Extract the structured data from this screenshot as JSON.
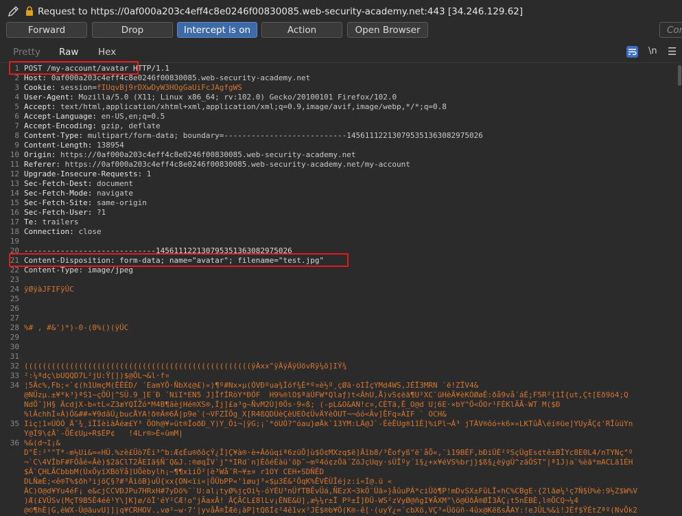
{
  "header": {
    "title": "Request to https://0af000a203c4eff4c8e0246f00830085.web-security-academy.net:443  [34.246.129.62]"
  },
  "toolbar": {
    "forward": "Forward",
    "drop": "Drop",
    "intercept": "Intercept is on",
    "action": "Action",
    "open_browser": "Open Browser",
    "comment_placeholder": "Comment this item"
  },
  "tabs": {
    "pretty": "Pretty",
    "raw": "Raw",
    "hex": "Hex",
    "newline": "\\n"
  },
  "editor": {
    "lines": [
      {
        "n": "1",
        "t": "POST /my-account/avatar HTTP/1.1"
      },
      {
        "n": "2",
        "t": "Host: 0af000a203c4eff4c8e0246f00830085.web-security-academy.net"
      },
      {
        "n": "3",
        "t": "Cookie: session=fIUqvBj9rDXwDyW3HOgGaUiFcJAgfgWS"
      },
      {
        "n": "4",
        "t": "User-Agent: Mozilla/5.0 (X11; Linux x86_64; rv:102.0) Gecko/20100101 Firefox/102.0"
      },
      {
        "n": "5",
        "t": "Accept: text/html,application/xhtml+xml,application/xml;q=0.9,image/avif,image/webp,*/*;q=0.8"
      },
      {
        "n": "6",
        "t": "Accept-Language: en-US,en;q=0.5"
      },
      {
        "n": "7",
        "t": "Accept-Encoding: gzip, deflate"
      },
      {
        "n": "8",
        "t": "Content-Type: multipart/form-data; boundary=---------------------------145611122130795351363082975026"
      },
      {
        "n": "9",
        "t": "Content-Length: 138954"
      },
      {
        "n": "10",
        "t": "Origin: https://0af000a203c4eff4c8e0246f00830085.web-security-academy.net"
      },
      {
        "n": "11",
        "t": "Referer: https://0af000a203c4eff4c8e0246f00830085.web-security-academy.net/my-account"
      },
      {
        "n": "12",
        "t": "Upgrade-Insecure-Requests: 1"
      },
      {
        "n": "13",
        "t": "Sec-Fetch-Dest: document"
      },
      {
        "n": "14",
        "t": "Sec-Fetch-Mode: navigate"
      },
      {
        "n": "15",
        "t": "Sec-Fetch-Site: same-origin"
      },
      {
        "n": "16",
        "t": "Sec-Fetch-User: ?1"
      },
      {
        "n": "17",
        "t": "Te: trailers"
      },
      {
        "n": "18",
        "t": "Connection: close"
      },
      {
        "n": "19",
        "t": ""
      },
      {
        "n": "20",
        "t": "-----------------------------145611122130795351363082975026"
      },
      {
        "n": "21",
        "t": "Content-Disposition: form-data; name=\"avatar\"; filename=\"test.jpg\""
      },
      {
        "n": "22",
        "t": "Content-Type: image/jpeg"
      },
      {
        "n": "23",
        "t": ""
      },
      {
        "n": "24",
        "t": "ÿØÿàJFIFÿÛC"
      },
      {
        "n": "25",
        "t": ""
      },
      {
        "n": "26",
        "t": ""
      },
      {
        "n": "27",
        "t": ""
      },
      {
        "n": "28",
        "t": "%# , #&')*)-0-(0%()(ÿÛC"
      },
      {
        "n": "29",
        "t": ""
      },
      {
        "n": "30",
        "t": ""
      },
      {
        "n": "31",
        "t": ""
      },
      {
        "n": "32",
        "t": "((((((((((((((((((((((((((((((((((((((((((((((((((ÿÀxx\"ÿÄÿÄÿÚövRÿ¼õ]IÝ¾"
      },
      {
        "n": "33",
        "t": "²:¼ªdç\\bUQQD7L²jU:Ÿ[])$@ÕL¬&l·f¤"
      },
      {
        "n": "34",
        "t": "¦5Ãc%,Fb;«`¢(h1UmçM(ÊÊÉD/ ´EamYÕ·ÑbX¢@£)«)¶º#Nx×µ(ÓVÐºua¾Íóf¾È*º¤è½º¸çØä·oIÍçYMd4WS,JÉÏ3MRN `ë!ZÏV4&"
      },
      {
        "n": "",
        "t": "@NÜzµ.±¥*k³}ªS1~çÕÛ|^SÜ.9_]E´Ð ´NïI*EN5 J]ÎfÍRòY*ÐÓF  H9%®lO$ªäÚFW*Qlaƒ)t<ÂhU,Å)vS¢ëã¶U²XC¨üHèÃ¥èKÓØøÊ:ðå9vå´áÉ;F5R²{1Í{ut,Çt[Eð9ö4;Q"
      },
      {
        "n": "",
        "t": "NdÖ¯]H§ ÄcdjX-b«tL«Z3æYQÏŽó*M4B¶äèjHé®XS®,Íj]£a³g~ÑvM2Ù]0Ös·9«ß; (-pL&O&AN!c¤,CÈTã,Ê_O@d U¦6E·×bY^Ö<ÖOr¹FÉKlÃÃ-WT M($Ð"
      },
      {
        "n": "",
        "t": "%lÃchhÌ¤À)Ö&##«¥9dâÚ¿bucÅYA!ð®Ã®6Ä|p9e`(¬VFZÏÕg_X[R4ßQDÙèÇèUEÒ¢ÜvÄYèÒUT¬¬óó<Ãv]ÊFq¤ÀIF ` OCH&"
      },
      {
        "n": "35",
        "t": "Iiç¦1¤ÙÒÓ_Ä¯¾¸ïÏÍèìàÁéæ£Y³ ÖOh@¥»üt®ÏoðÐ_Y)Y_Ôi¬|ÿG;¡`*öUÓ?^óau}øÄk`13YM:LÄ@J`-ÉèÊUg®11È]%iPl¬Á³ jTÀV®ôó÷k6×«LKTûÅ\\éí®üe]YUyÃÇ¢'RÎùüYn"
      },
      {
        "n": "",
        "t": "Y@Ì9\\¢Ä`-ÕÉ¢Uµ+R$ÉP¢   !4Lr®>È«ümM|"
      },
      {
        "n": "36",
        "t": "%&(d¬I¡&"
      },
      {
        "n": "",
        "t": "D\"Ë:²°\"T*-m½Ui&=«HÜ.%zè£Üò7Èi³^b:Æ¢Éu®ðôçÝ¿Î]Ç¥à®·è+Âõûqiª6züÕ]ù$Ó¢MXzq$ë]Âîb8/³Êofyß\"ë`åÕ«,¨ì19BÉF,bÐiÛÈ²ºSçÙgEs¢tê±BÌYc8E0L4/nTYNç\"º"
      },
      {
        "n": "",
        "t": "¬`C\\4VÎbF#FÕåé«Âè)$2ãClT2ÂEIã§Ñ¨Q&J.:®øqÎV`j\"*IRd`n]ÈôéÉàü'öþ¯~mº4ó¢zÔã´ZöJçUqy·sÜÎºy´ï§¿+x¥éVS%brj}$ß§¿èÿgÙ^zãÖST\"|ª1J)a`%èã*mACLã1ÉH"
      },
      {
        "n": "",
        "t": "$Ä`ÇHLÃCbbbM(ÙxÖyïXBöŸå]UÕèbylh¡~¶¶xìiÖ²|è³Wå¯R¬¥±¤ r1OY CEH+SDÑÊD"
      },
      {
        "n": "",
        "t": "DLÑæÈ;<ê®T%$ðh³ijõÇ§?#³ÄìöB}uÜ{xx{ON<ïi«|ÖÜbPP«'ìøuj³«$µ3É&²ÕqK%ÊVÊÜÎéjz:í«Í@.ü «"
      },
      {
        "n": "",
        "t": "ÀC)O@d¥Yu4éF¡ e&cjCCVÐJPu7HRxH#7yDõ%¨`U:al¡tyØ%jçOi½-óYÉU³nÜfTBÊvÜá,ÑEzX¬3kÖ¨Üã»}åûuPÁ*ciÛõ¶P!mDvSX±FûLÏ«hC%CBgE·{2lãø¼¹ç7Ñ§Ù%è:9½Z$W%V"
      },
      {
        "n": "",
        "t": ")Æ(£VÜSv(MçT9B5È4éê¹Y\\]K]ø/õÏ'éY²CÆ!o\"jÃaxÂ! ÄÇÃCL£8lLv¡ÈNE&Ù],æ½¼r±Ï Pº±Í]ÐÛ-WS²zVyØ@ñgI¥ÃXM\"\\ö@ÚðÂ®ØÌ3ÄÇ¡t5nÉBÈ,l®ÕCQ¬¼4"
      },
      {
        "n": "",
        "t": "@©¶hÈ|G,èWX-Ü@ãuvU]]|q¥CRHOV.,vø²~w·7'|yvåÅ®ÎÆè¡àP]tQßÍ¢²4ê1vx²JÈ$®b¥Ö(K®-ê[·(uyŸ¿=´cbXö,VÇ³«Üõüñ-4ûx@KëßsÅAY:!eJÜL%&ì!JÉf$ŸÉtZªº(NvÕk2"
      }
    ]
  }
}
